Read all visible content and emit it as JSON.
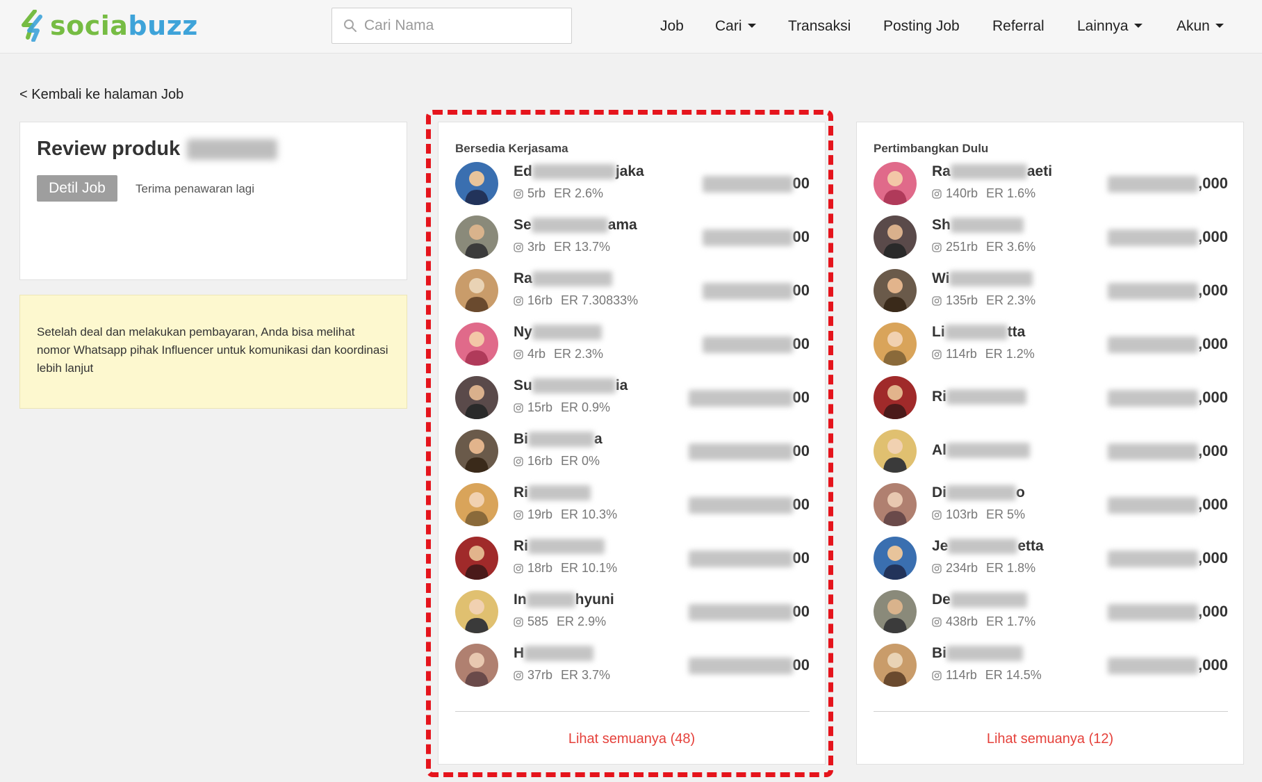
{
  "header": {
    "logo_part1": "socia",
    "logo_part2": "buzz",
    "search_placeholder": "Cari Nama",
    "nav": [
      {
        "label": "Job",
        "caret": false
      },
      {
        "label": "Cari",
        "caret": true
      },
      {
        "label": "Transaksi",
        "caret": false
      },
      {
        "label": "Posting Job",
        "caret": false
      },
      {
        "label": "Referral",
        "caret": false
      },
      {
        "label": "Lainnya",
        "caret": true
      },
      {
        "label": "Akun",
        "caret": true
      }
    ]
  },
  "back_link": "< Kembali ke halaman Job",
  "job": {
    "title": "Review produk",
    "detail_button": "Detil Job",
    "accept_more": "Terima penawaran lagi"
  },
  "notice": "Setelah deal dan melakukan pembayaran, Anda bisa melihat nomor Whatsapp pihak Influencer untuk komunikasi dan koordinasi lebih lanjut",
  "colors": {
    "accent": "#e5413b",
    "highlight": "#e5141c",
    "logo_green": "#76bc43",
    "logo_blue": "#3ea3d9"
  },
  "panels": [
    {
      "title": "Bersedia Kerjasama",
      "see_all": "Lihat semuanya (48)",
      "rows": [
        {
          "name_start": "Ed",
          "name_end": "jaka",
          "followers": "5rb",
          "er": "ER 2.6%",
          "price_end": "00"
        },
        {
          "name_start": "Se",
          "name_end": "ama",
          "followers": "3rb",
          "er": "ER 13.7%",
          "price_end": "00"
        },
        {
          "name_start": "Ra",
          "name_end": "",
          "followers": "16rb",
          "er": "ER 7.30833%",
          "price_end": "00"
        },
        {
          "name_start": "Ny",
          "name_end": "",
          "followers": "4rb",
          "er": "ER 2.3%",
          "price_end": "00"
        },
        {
          "name_start": "Su",
          "name_end": "ia",
          "followers": "15rb",
          "er": "ER 0.9%",
          "price_end": "00"
        },
        {
          "name_start": "Bi",
          "name_end": "a",
          "followers": "16rb",
          "er": "ER 0%",
          "price_end": "00"
        },
        {
          "name_start": "Ri",
          "name_end": "",
          "followers": "19rb",
          "er": "ER 10.3%",
          "price_end": "00"
        },
        {
          "name_start": "Ri",
          "name_end": "",
          "followers": "18rb",
          "er": "ER 10.1%",
          "price_end": "00"
        },
        {
          "name_start": "In",
          "name_end": "hyuni",
          "followers": "585",
          "er": "ER 2.9%",
          "price_end": "00"
        },
        {
          "name_start": "H",
          "name_end": "",
          "followers": "37rb",
          "er": "ER 3.7%",
          "price_end": "00"
        }
      ]
    },
    {
      "title": "Pertimbangkan Dulu",
      "see_all": "Lihat semuanya (12)",
      "rows": [
        {
          "name_start": "Ra",
          "name_end": "aeti",
          "followers": "140rb",
          "er": "ER 1.6%",
          "price_end": ",000"
        },
        {
          "name_start": "Sh",
          "name_end": "",
          "followers": "251rb",
          "er": "ER 3.6%",
          "price_end": ",000"
        },
        {
          "name_start": "Wi",
          "name_end": "",
          "followers": "135rb",
          "er": "ER 2.3%",
          "price_end": ",000"
        },
        {
          "name_start": "Li",
          "name_end": "tta",
          "followers": "114rb",
          "er": "ER 1.2%",
          "price_end": ",000"
        },
        {
          "name_start": "Ri",
          "name_end": "",
          "followers": "",
          "er": "",
          "price_end": ",000"
        },
        {
          "name_start": "Al",
          "name_end": "",
          "followers": "",
          "er": "",
          "price_end": ",000"
        },
        {
          "name_start": "Di",
          "name_end": "o",
          "followers": "103rb",
          "er": "ER 5%",
          "price_end": ",000"
        },
        {
          "name_start": "Je",
          "name_end": "etta",
          "followers": "234rb",
          "er": "ER 1.8%",
          "price_end": ",000"
        },
        {
          "name_start": "De",
          "name_end": "",
          "followers": "438rb",
          "er": "ER 1.7%",
          "price_end": ",000"
        },
        {
          "name_start": "Bi",
          "name_end": "",
          "followers": "114rb",
          "er": "ER 14.5%",
          "price_end": ",000"
        }
      ]
    }
  ]
}
